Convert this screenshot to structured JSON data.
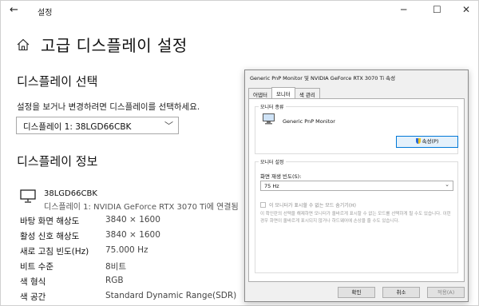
{
  "window": {
    "back_glyph": "←",
    "title": "설정",
    "min_glyph": "─",
    "max_glyph": "☐",
    "close_glyph": "✕"
  },
  "page": {
    "title": "고급 디스플레이 설정"
  },
  "select_section": {
    "heading": "디스플레이 선택",
    "description": "설정을 보거나 변경하려면 디스플레이를 선택하세요.",
    "dropdown_value": "디스플레이 1: 38LGD66CBK",
    "dropdown_chevron": "﹀"
  },
  "info_section": {
    "heading": "디스플레이 정보",
    "monitor_name": "38LGD66CBK",
    "monitor_sub": "디스플레이 1: NVIDIA GeForce RTX 3070 Ti에 연결됨",
    "rows": [
      {
        "label": "바탕 화면 해상도",
        "value": "3840 × 1600"
      },
      {
        "label": "활성 신호 해상도",
        "value": "3840 × 1600"
      },
      {
        "label": "새로 고침 빈도(Hz)",
        "value": "75.000 Hz"
      },
      {
        "label": "비트 수준",
        "value": "8비트"
      },
      {
        "label": "색 형식",
        "value": "RGB"
      },
      {
        "label": "색 공간",
        "value": "Standard Dynamic Range(SDR)"
      }
    ]
  },
  "dialog": {
    "title": "Generic PnP Monitor 및 NVIDIA GeForce RTX 3070 Ti 속성",
    "tabs": [
      "어댑터",
      "모니터",
      "색 관리"
    ],
    "monitor_type_group": "모니터 종류",
    "monitor_type_name": "Generic PnP Monitor",
    "properties_button": "속성(P)",
    "settings_group": "모니터 설정",
    "refresh_label": "화면 재생 빈도(S):",
    "refresh_value": "75 Hz",
    "refresh_chevron": "⌄",
    "hide_modes_label": "이 모니터가 표시할 수 없는 모드 숨기기(H)",
    "warning_text": "이 확인란의 선택을 해제하면 모니터가 올바르게 표시할 수 없는 모드를 선택하게 될 수도 있습니다. 이런 경우 화면이 올바르게 표시되지 않거나 하드웨어에 손상을 줄 수도 있습니다.",
    "ok": "확인",
    "cancel": "취소",
    "apply": "적용(A)"
  }
}
